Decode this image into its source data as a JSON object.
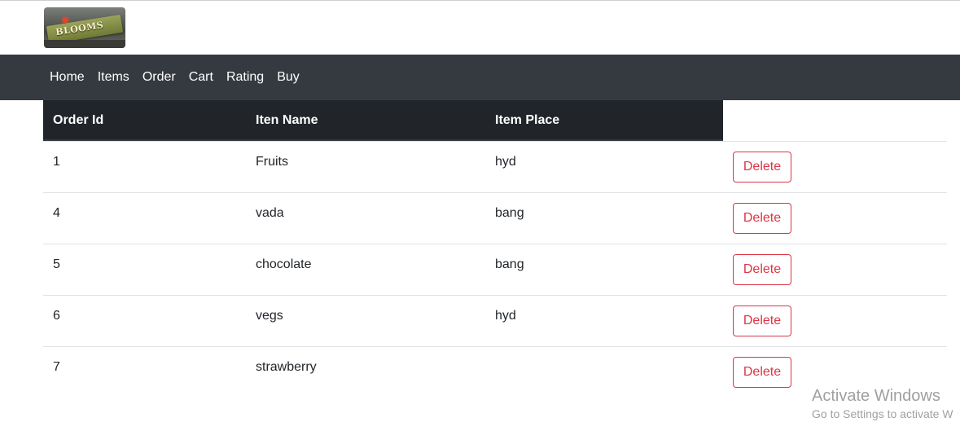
{
  "logo": {
    "text": "BLOOMS",
    "star": "✸"
  },
  "nav": {
    "items": [
      {
        "label": "Home"
      },
      {
        "label": "Items"
      },
      {
        "label": "Order"
      },
      {
        "label": "Cart"
      },
      {
        "label": "Rating"
      },
      {
        "label": "Buy"
      }
    ]
  },
  "table": {
    "headers": [
      "Order Id",
      "Iten Name",
      "Item Place"
    ],
    "delete_label": "Delete",
    "rows": [
      {
        "id": "1",
        "name": "Fruits",
        "place": "hyd"
      },
      {
        "id": "4",
        "name": "vada",
        "place": "bang"
      },
      {
        "id": "5",
        "name": "chocolate",
        "place": "bang"
      },
      {
        "id": "6",
        "name": "vegs",
        "place": "hyd"
      },
      {
        "id": "7",
        "name": "strawberry",
        "place": ""
      }
    ]
  },
  "watermark": {
    "title": "Activate Windows",
    "subtitle": "Go to Settings to activate W"
  },
  "colors": {
    "navbar": "#343a40",
    "table_header": "#212529",
    "danger": "#dc3545"
  }
}
